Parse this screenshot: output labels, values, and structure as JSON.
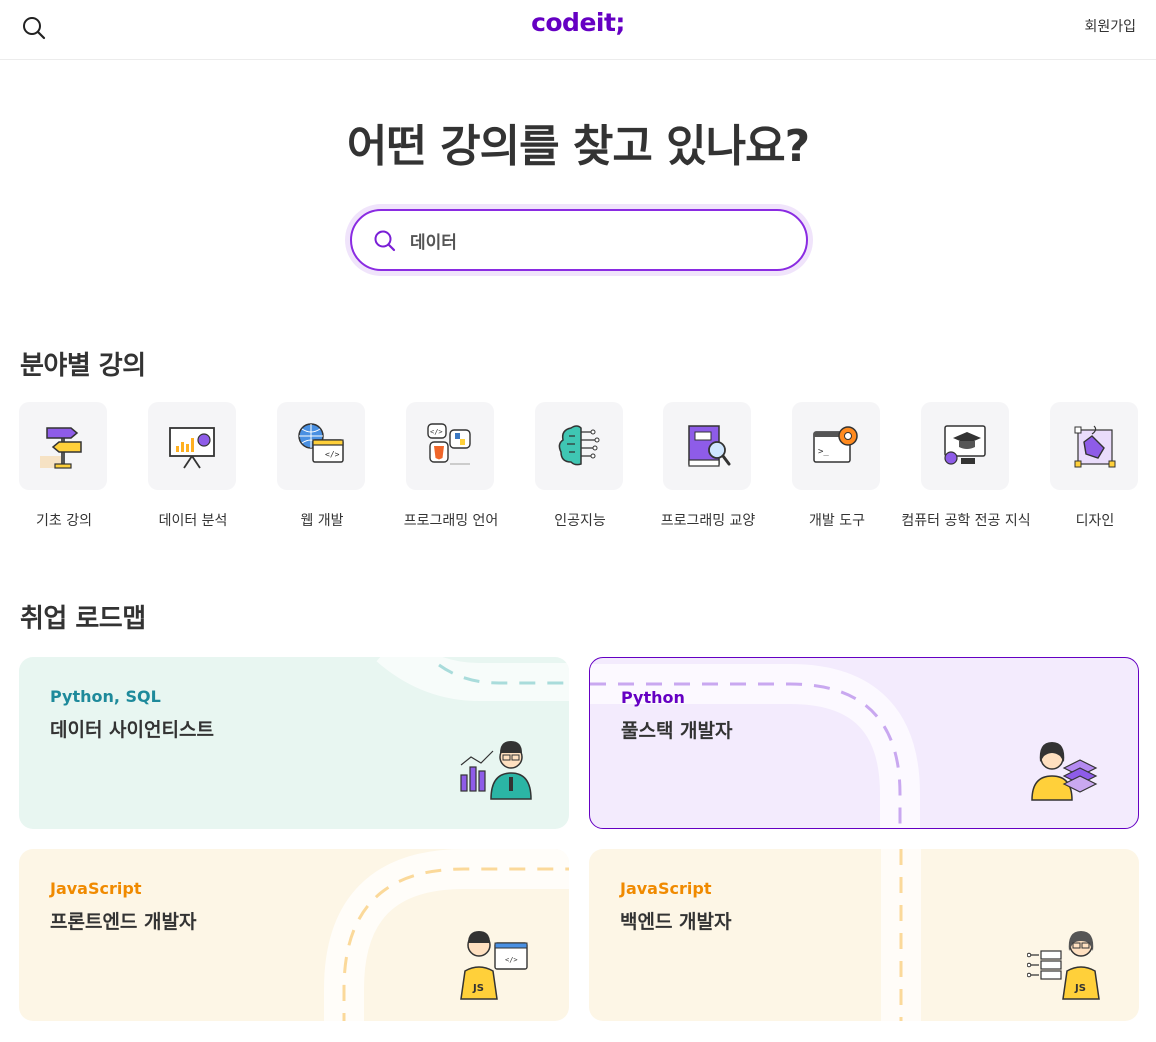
{
  "header": {
    "logo": "codeit;",
    "signup_label": "회원가입"
  },
  "hero": {
    "title": "어떤 강의를 찾고 있나요?",
    "search_value": "데이터"
  },
  "categories_section": {
    "title": "분야별 강의",
    "items": [
      {
        "label": "기초 강의",
        "icon": "signpost-icon"
      },
      {
        "label": "데이터 분석",
        "icon": "chart-board-icon"
      },
      {
        "label": "웹 개발",
        "icon": "globe-browser-icon"
      },
      {
        "label": "프로그래밍 언어",
        "icon": "language-bubbles-icon"
      },
      {
        "label": "인공지능",
        "icon": "brain-circuit-icon"
      },
      {
        "label": "프로그래밍 교양",
        "icon": "book-magnifier-icon"
      },
      {
        "label": "개발 도구",
        "icon": "terminal-gear-icon"
      },
      {
        "label": "컴퓨터 공학 전공 지식",
        "icon": "graduation-monitor-icon"
      },
      {
        "label": "디자인",
        "icon": "pen-tool-icon"
      }
    ]
  },
  "roadmap_section": {
    "title": "취업 로드맵",
    "cards": [
      {
        "tech": "Python, SQL",
        "role": "데이터 사이언티스트",
        "bg": "#e8f6f1",
        "accent": "#1e8a9b",
        "icon": "data-scientist-icon"
      },
      {
        "tech": "Python",
        "role": "풀스택 개발자",
        "bg": "#f3ebfd",
        "accent": "#6500c3",
        "icon": "fullstack-developer-icon"
      },
      {
        "tech": "JavaScript",
        "role": "프론트엔드 개발자",
        "bg": "#fdf6e6",
        "accent": "#f08a00",
        "icon": "frontend-developer-icon"
      },
      {
        "tech": "JavaScript",
        "role": "백엔드 개발자",
        "bg": "#fdf6e6",
        "accent": "#f08a00",
        "icon": "backend-developer-icon"
      }
    ]
  }
}
